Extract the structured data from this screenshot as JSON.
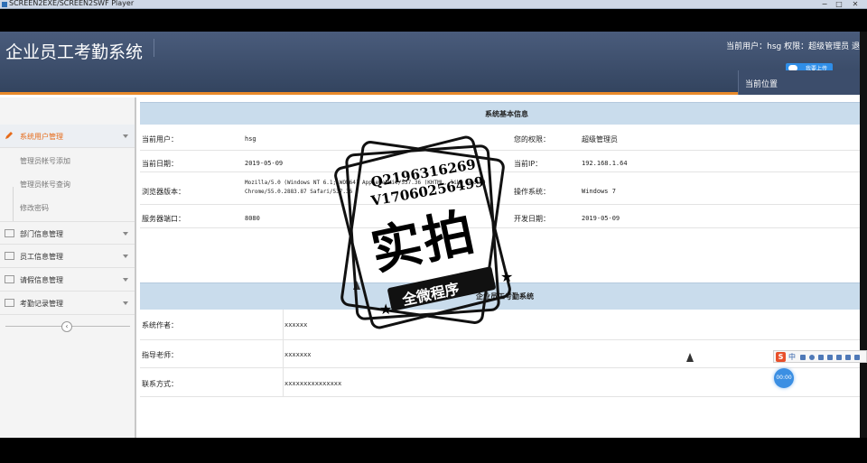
{
  "player": {
    "title": "SCREEN2EXE/SCREEN2SWF Player",
    "minimize": "−",
    "maximize": "□",
    "close": "✕"
  },
  "header": {
    "app_title": "企业员工考勤系统",
    "user_info": "当前用户：hsg 权限：超级管理员 退",
    "current_position": "当前位置",
    "upload_badge": "我要上传"
  },
  "sidebar": {
    "items": [
      {
        "label": "系统用户管理",
        "icon": "pencil-icon",
        "active": true
      },
      {
        "label": "部门信息管理",
        "icon": "keyboard-icon"
      },
      {
        "label": "员工信息管理",
        "icon": "monitor-icon"
      },
      {
        "label": "请假信息管理",
        "icon": "list-icon"
      },
      {
        "label": "考勤记录管理",
        "icon": "calendar-icon"
      }
    ],
    "sub_items": [
      {
        "label": "管理员帐号添加"
      },
      {
        "label": "管理员帐号查询"
      },
      {
        "label": "修改密码"
      }
    ],
    "collapse_glyph": "‹"
  },
  "main": {
    "section1_title": "系统基本信息",
    "rows": [
      {
        "k1": "当前用户：",
        "v1": "hsg",
        "k2": "您的权限：",
        "v2": "超级管理员"
      },
      {
        "k1": "当前日期：",
        "v1": "2019-05-09",
        "k2": "当前IP：",
        "v2": "192.168.1.64"
      },
      {
        "k1": "浏览器版本：",
        "v1a": "Mozilla/5.0 (Windows NT 6.1; WOW64) AppleWebKit/537.36 (KHTML, like Gecko)",
        "v1b": "Chrome/55.0.2883.87 Safari/537.36",
        "k2": "操作系统：",
        "v2": "Windows 7"
      },
      {
        "k1": "服务器端口：",
        "v1": "8080",
        "k2": "开发日期：",
        "v2": "2019-05-09"
      }
    ],
    "section2_title": "企业员工考勤系统",
    "rows2": [
      {
        "k": "系统作者：",
        "v": "xxxxxx"
      },
      {
        "k": "指导老师：",
        "v": "xxxxxxx"
      },
      {
        "k": "联系方式：",
        "v": "xxxxxxxxxxxxxxx"
      }
    ]
  },
  "ime": {
    "logo": "S",
    "mode": "中"
  },
  "timer": "00:00",
  "watermark": {
    "qq": "Q2196316269",
    "v": "V17060256499",
    "big": "实拍",
    "ribbon": "全微程序"
  },
  "colors": {
    "header": "#3b4d6b",
    "accent_orange": "#e98a2a",
    "section_head": "#c9dcec",
    "active_text": "#e66b1a"
  }
}
